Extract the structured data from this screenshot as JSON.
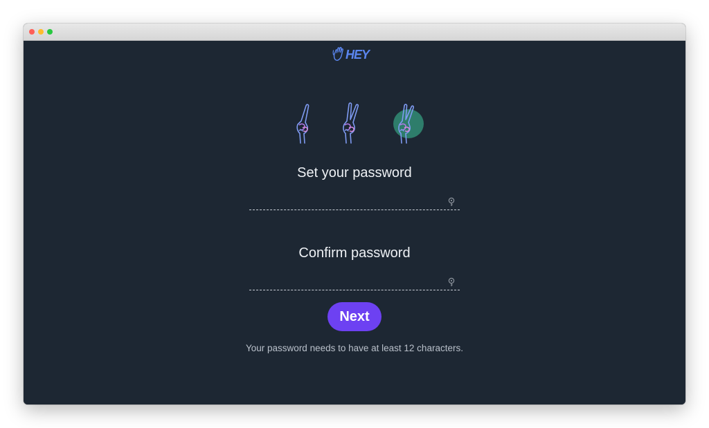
{
  "window": {
    "controls": [
      "close",
      "minimize",
      "zoom"
    ]
  },
  "logo": {
    "text": "HEY",
    "icon": "waving-hand-icon",
    "color": "#5b86f0"
  },
  "progress": {
    "steps": [
      "peace-hand-icon",
      "peace-hand-icon",
      "peace-hand-icon"
    ],
    "current_step": 3,
    "total_steps": 3
  },
  "form": {
    "password_label": "Set your password",
    "password_value": "",
    "confirm_label": "Confirm password",
    "confirm_value": "",
    "reveal_icon": "key-icon",
    "next_label": "Next",
    "hint": "Your password needs to have at least 12 characters."
  },
  "colors": {
    "background": "#1d2733",
    "accent": "#6d41f2",
    "text": "#eef1f5",
    "hint": "#b9c0ca",
    "active_step": "#2e7d6b"
  }
}
